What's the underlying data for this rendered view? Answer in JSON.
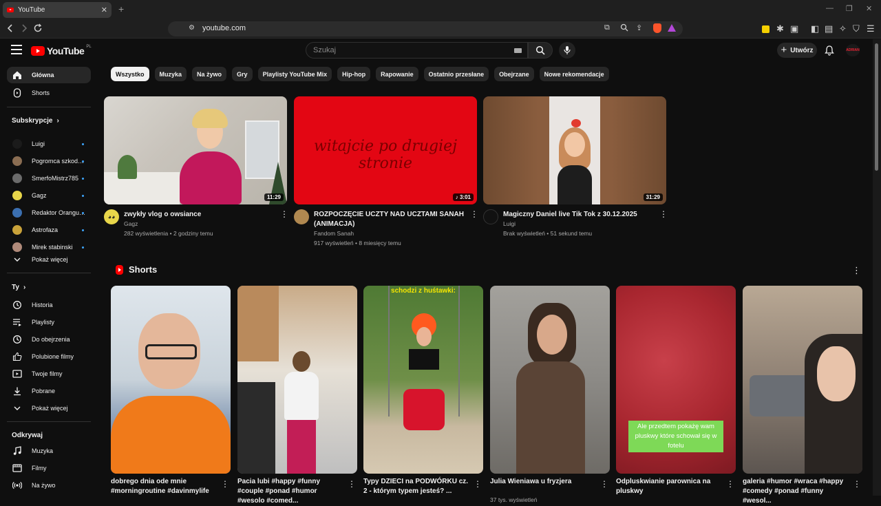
{
  "browser": {
    "tab_title": "YouTube",
    "url": "youtube.com"
  },
  "header": {
    "logo_text": "YouTube",
    "logo_country": "PL",
    "search_placeholder": "Szukaj",
    "create_label": "Utwórz",
    "avatar_text": "ADRIAN"
  },
  "sidebar": {
    "main": [
      {
        "label": "Główna",
        "icon": "home-icon",
        "active": true
      },
      {
        "label": "Shorts",
        "icon": "shorts-icon",
        "active": false
      }
    ],
    "subscriptions_heading": "Subskrypcje",
    "subscriptions": [
      {
        "label": "Luigi",
        "color": "#1b1b1b"
      },
      {
        "label": "Pogromca szkodni...",
        "color": "#8a6d52"
      },
      {
        "label": "SmerfoMistrz785",
        "color": "#6b6b6b"
      },
      {
        "label": "Gagz",
        "color": "#e8d64a"
      },
      {
        "label": "Redaktor Orangutan",
        "color": "#3b6fb0"
      },
      {
        "label": "Astrofaza",
        "color": "#c9a23a"
      },
      {
        "label": "Mirek stabinski",
        "color": "#b08a7a"
      }
    ],
    "show_more_1": "Pokaż więcej",
    "you_heading": "Ty",
    "you_items": [
      {
        "label": "Historia",
        "icon": "history-icon"
      },
      {
        "label": "Playlisty",
        "icon": "playlist-icon"
      },
      {
        "label": "Do obejrzenia",
        "icon": "clock-icon"
      },
      {
        "label": "Polubione filmy",
        "icon": "thumbs-up-icon"
      },
      {
        "label": "Twoje filmy",
        "icon": "your-videos-icon"
      },
      {
        "label": "Pobrane",
        "icon": "download-icon"
      }
    ],
    "show_more_2": "Pokaż więcej",
    "explore_heading": "Odkrywaj",
    "explore_items": [
      {
        "label": "Muzyka",
        "icon": "music-icon"
      },
      {
        "label": "Filmy",
        "icon": "film-icon"
      },
      {
        "label": "Na żywo",
        "icon": "live-icon"
      }
    ]
  },
  "chips": [
    "Wszystko",
    "Muzyka",
    "Na żywo",
    "Gry",
    "Playlisty YouTube Mix",
    "Hip-hop",
    "Rapowanie",
    "Ostatnio przesłane",
    "Obejrzane",
    "Nowe rekomendacje"
  ],
  "videos": [
    {
      "title": "zwykły vlog o owsiance",
      "channel": "Gagz",
      "stats": "282 wyświetlenia • 2 godziny temu",
      "duration": "11:29"
    },
    {
      "title": "ROZPOCZĘCIE UCZTY NAD UCZTAMI SANAH (ANIMACJA)",
      "channel": "Fandom Sanah",
      "stats": "917 wyświetleń • 8 miesięcy temu",
      "duration": "3:01",
      "thumb_text": "witajcie po drugiej stronie"
    },
    {
      "title": "Magiczny Daniel live Tik Tok z 30.12.2025",
      "channel": "Luigi",
      "stats": "Brak wyświetleń • 51 sekund temu",
      "duration": "31:29"
    }
  ],
  "shorts": {
    "heading": "Shorts",
    "items": [
      {
        "title": "dobrego dnia ode mnie #morningroutine #davinmylife"
      },
      {
        "title": "Pacia lubi #happy #funny #couple #ponad #humor #wesolo #comed..."
      },
      {
        "title": "Typy DZIECI na PODWÓRKU cz. 2 - którym typem jesteś? ...",
        "overlay": "schodzi z huśtawki:"
      },
      {
        "title": "Julia Wieniawa u fryzjera",
        "meta": "37 tys. wyświetleń"
      },
      {
        "title": "Odpluskwianie parownica na pluskwy",
        "overlay": "Ale przedtem pokażę wam pluskwy które schował się w fotelu"
      },
      {
        "title": "galeria #humor #wraca #happy #comedy #ponad #funny #wesol..."
      }
    ]
  }
}
